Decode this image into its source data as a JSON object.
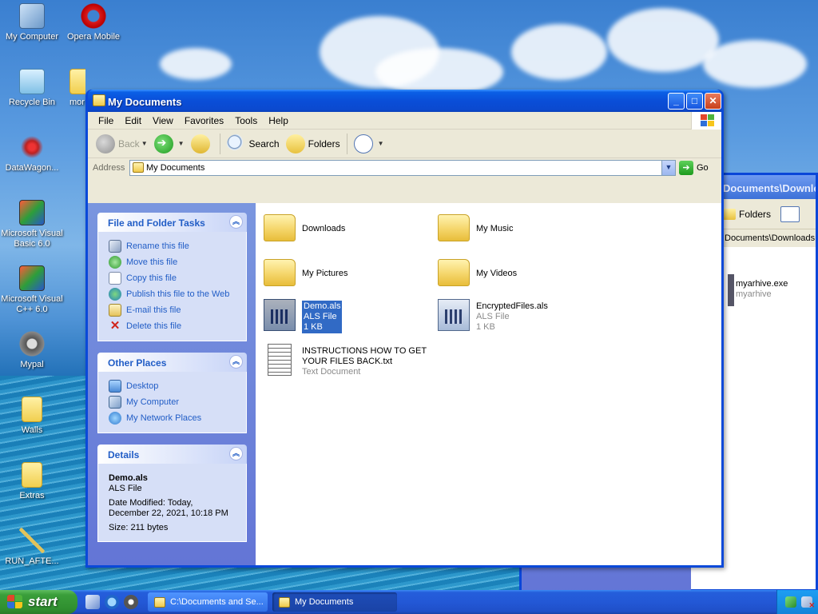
{
  "desktop": {
    "icons": [
      {
        "label": "My Computer",
        "icon": "my-computer-icon"
      },
      {
        "label": "Opera Mobile",
        "icon": "opera-icon"
      },
      {
        "label": "Recycle Bin",
        "icon": "recycle-bin-icon"
      },
      {
        "label": "mor",
        "icon": "folder-icon"
      },
      {
        "label": "DataWagon...",
        "icon": "datawagon-icon"
      },
      {
        "label": "Microsoft Visual Basic 6.0",
        "icon": "visual-basic-icon"
      },
      {
        "label": "Microsoft Visual C++ 6.0",
        "icon": "visual-cpp-icon"
      },
      {
        "label": "Mypal",
        "icon": "mypal-icon"
      },
      {
        "label": "Walls",
        "icon": "folder-icon"
      },
      {
        "label": "Extras",
        "icon": "folder-icon"
      },
      {
        "label": "RUN_AFTE...",
        "icon": "wand-icon"
      }
    ]
  },
  "bg_window": {
    "title": "Documents\\Downloa",
    "folders_label": "Folders",
    "address": "Documents\\Downloads",
    "file_name": "myarhive.exe",
    "file_type": "myarhive"
  },
  "window": {
    "title": "My Documents",
    "minimize": "_",
    "maximize": "□",
    "close": "✕",
    "menu": [
      "File",
      "Edit",
      "View",
      "Favorites",
      "Tools",
      "Help"
    ],
    "toolbar": {
      "back": "Back",
      "search": "Search",
      "folders": "Folders"
    },
    "address": {
      "label": "Address",
      "value": "My Documents",
      "go": "Go"
    }
  },
  "tasks": {
    "file_folder": {
      "title": "File and Folder Tasks",
      "items": [
        "Rename this file",
        "Move this file",
        "Copy this file",
        "Publish this file to the Web",
        "E-mail this file",
        "Delete this file"
      ]
    },
    "other_places": {
      "title": "Other Places",
      "items": [
        "Desktop",
        "My Computer",
        "My Network Places"
      ]
    },
    "details": {
      "title": "Details",
      "name": "Demo.als",
      "type": "ALS File",
      "modified_1": "Date Modified: Today,",
      "modified_2": "December 22, 2021, 10:18 PM",
      "size": "Size: 211 bytes"
    }
  },
  "files": [
    {
      "name": "Downloads",
      "kind": "folder"
    },
    {
      "name": "My Music",
      "kind": "folder"
    },
    {
      "name": "My Pictures",
      "kind": "folder"
    },
    {
      "name": "My Videos",
      "kind": "folder"
    },
    {
      "name": "Demo.als",
      "type": "ALS File",
      "size": "1 KB",
      "selected": true
    },
    {
      "name": "EncryptedFiles.als",
      "type": "ALS File",
      "size": "1 KB"
    },
    {
      "name_1": "INSTRUCTIONS HOW TO GET",
      "name_2": "YOUR FILES BACK.txt",
      "type": "Text Document"
    }
  ],
  "taskbar": {
    "start": "start",
    "tasks": [
      "C:\\Documents and Se...",
      "My Documents"
    ]
  },
  "colors": {
    "title_blue": "#0a4ed8",
    "task_pane": "#6375d6",
    "selection": "#316ac5",
    "start_green": "#3a9e3a"
  }
}
